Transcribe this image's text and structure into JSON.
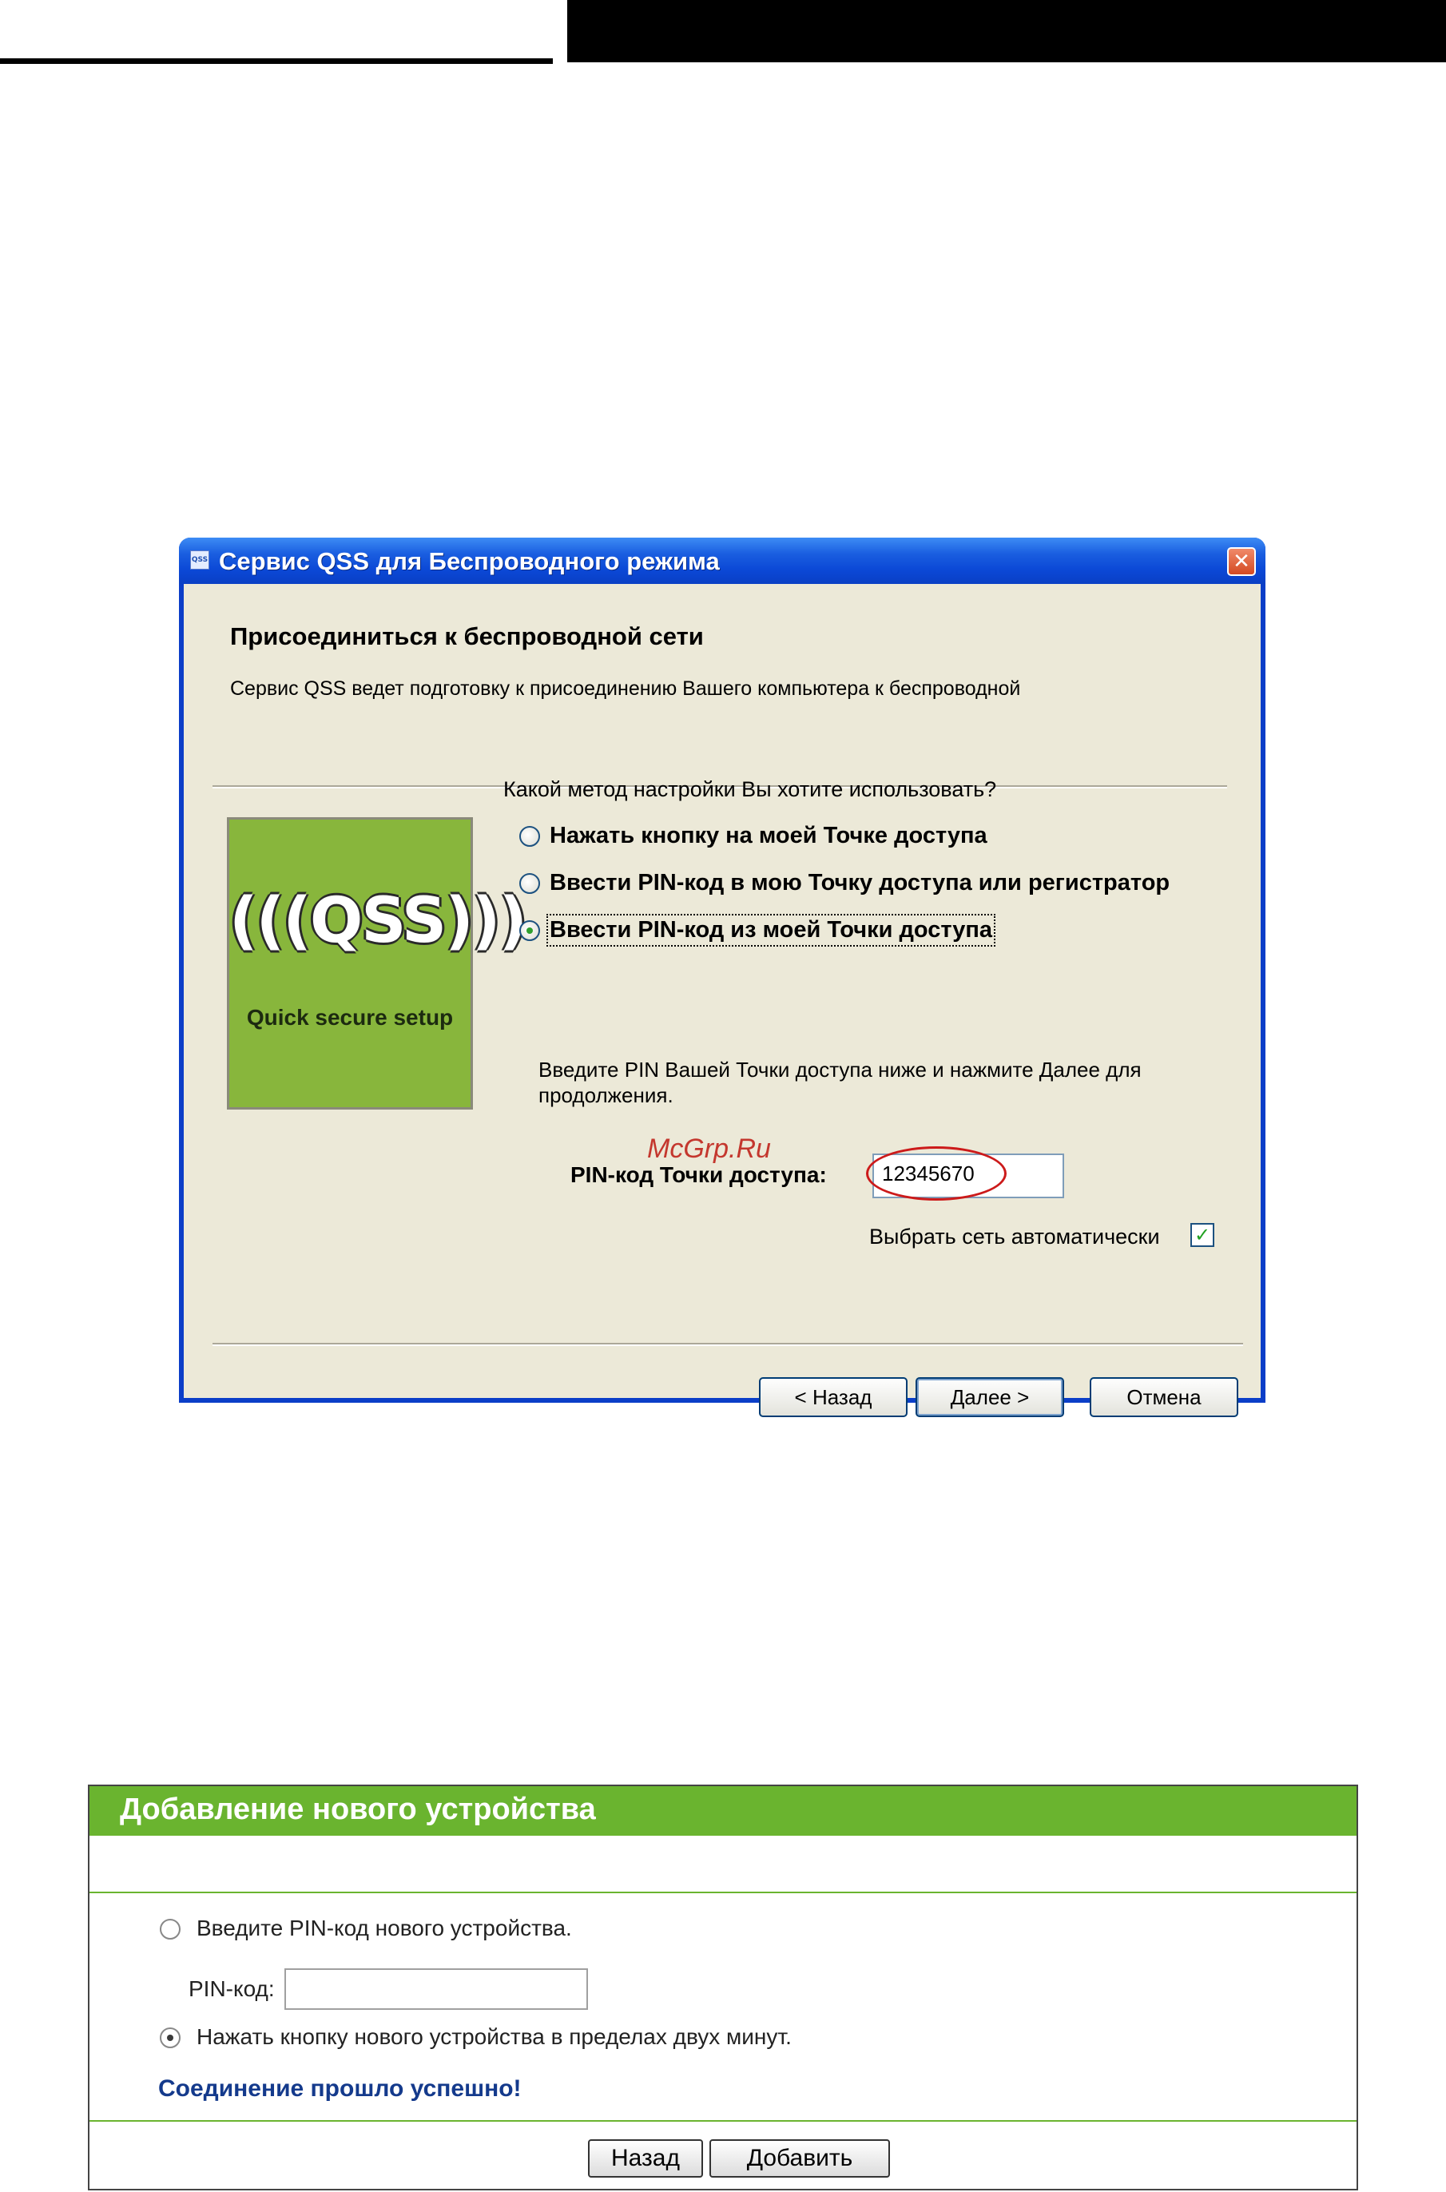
{
  "dialog": {
    "icon_text": "QSS",
    "title": "Сервис QSS для Беспроводного режима",
    "close_glyph": "✕",
    "heading": "Присоединиться к беспроводной сети",
    "description": "Сервис QSS ведет подготовку к присоединению Вашего компьютера к беспроводной",
    "logo_word": "(((QSS)))",
    "logo_caption": "Quick secure setup",
    "question": "Какой метод настройки Вы хотите использовать?",
    "options": [
      {
        "label": "Нажать кнопку на моей Точке доступа",
        "selected": false
      },
      {
        "label": "Ввести PIN-код в мою Точку доступа или регистратор",
        "selected": false
      },
      {
        "label": "Ввести PIN-код  из моей Точки доступа",
        "selected": true
      }
    ],
    "hint": "Введите PIN Вашей Точки доступа ниже и нажмите Далее для продолжения.",
    "pin_label": "PIN-код Точки доступа:",
    "pin_value": "12345670",
    "watermark": "McGrp.Ru",
    "auto_select_label": "Выбрать сеть автоматически",
    "auto_select_checked": true,
    "check_glyph": "✓",
    "buttons": {
      "back": "< Назад",
      "next": "Далее >",
      "cancel": "Отмена"
    }
  },
  "panel": {
    "title": "Добавление нового устройства",
    "option_pin": "Введите PIN-код нового устройства.",
    "option_pin_selected": false,
    "pin_label": "PIN-код:",
    "pin_value": "",
    "option_button": "Нажать кнопку нового устройства в пределах двух минут.",
    "option_button_selected": true,
    "success": "Соединение прошло успешно!",
    "buttons": {
      "back": "Назад",
      "add": "Добавить"
    },
    "accent": "#6ab42f"
  }
}
